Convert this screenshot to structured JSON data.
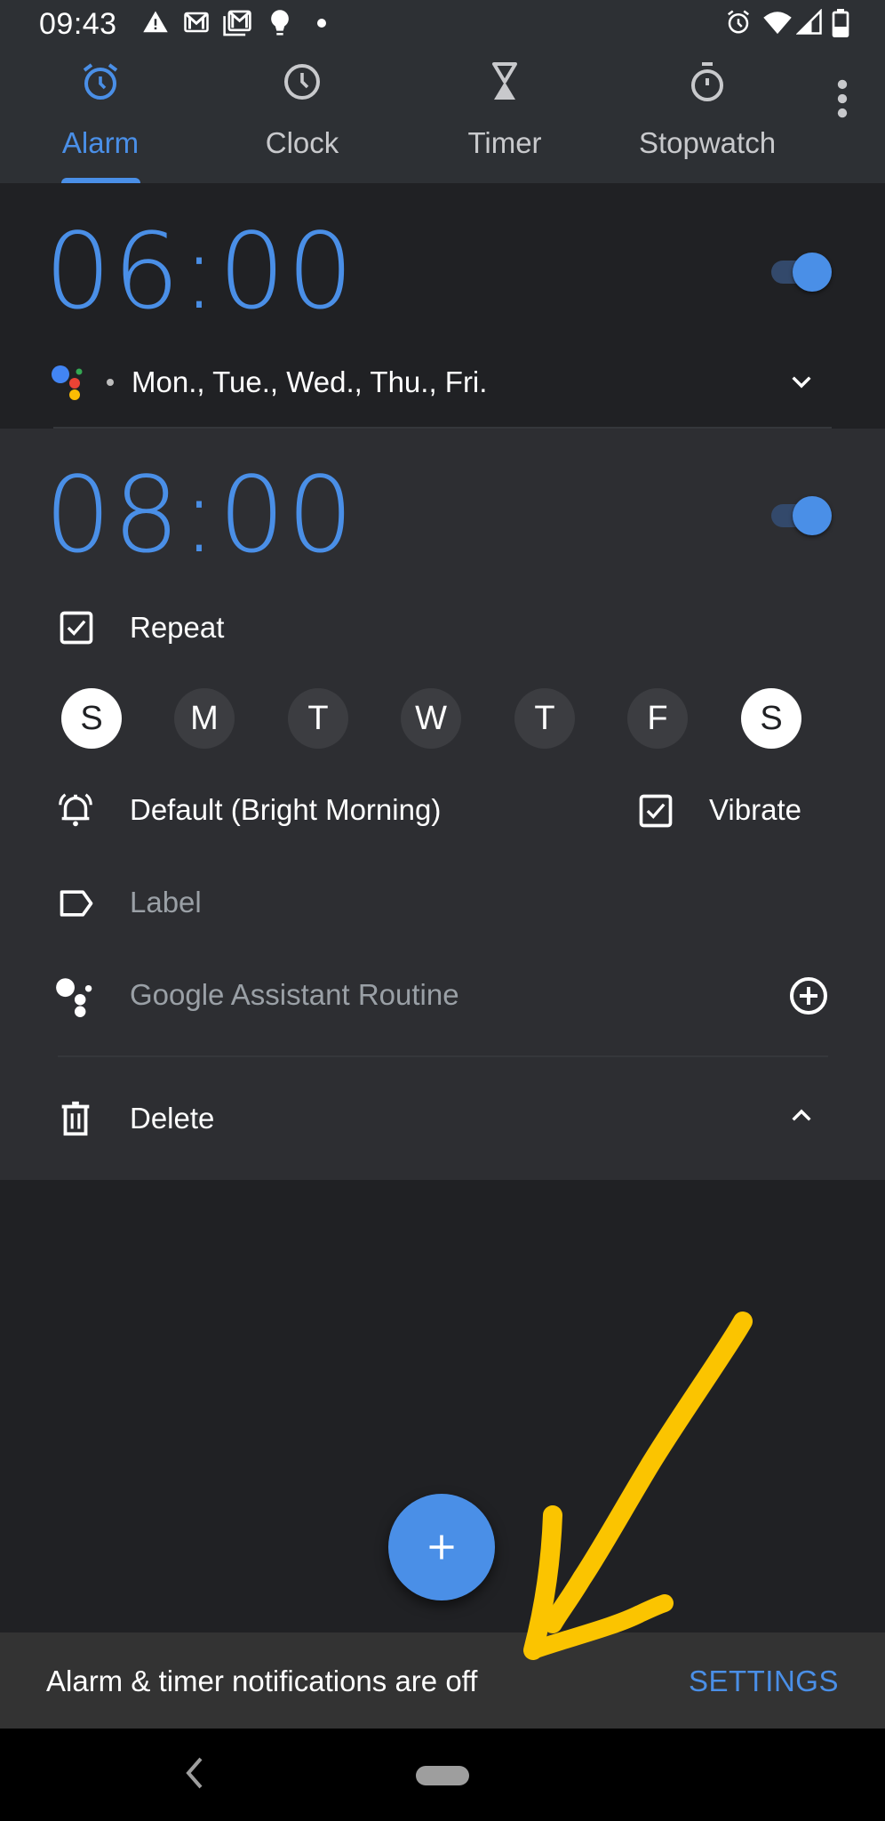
{
  "status_bar": {
    "time": "09:43",
    "left_icons": [
      "warning-icon",
      "gmail-icon",
      "gmail-stack-icon",
      "lightbulb-icon",
      "dot-icon"
    ],
    "right_icons": [
      "alarm-icon",
      "wifi-icon",
      "signal-icon",
      "battery-icon"
    ]
  },
  "tabs": [
    {
      "label": "Alarm",
      "icon": "alarm-icon",
      "active": true
    },
    {
      "label": "Clock",
      "icon": "clock-icon",
      "active": false
    },
    {
      "label": "Timer",
      "icon": "hourglass-icon",
      "active": false
    },
    {
      "label": "Stopwatch",
      "icon": "stopwatch-icon",
      "active": false
    }
  ],
  "alarms": [
    {
      "time": "06:00",
      "enabled": true,
      "days_summary": "Mon., Tue., Wed., Thu., Fri.",
      "expanded": false
    },
    {
      "time": "08:00",
      "enabled": true,
      "expanded": true,
      "repeat_label": "Repeat",
      "repeat_checked": true,
      "days": [
        {
          "letter": "S",
          "selected": true
        },
        {
          "letter": "M",
          "selected": false
        },
        {
          "letter": "T",
          "selected": false
        },
        {
          "letter": "W",
          "selected": false
        },
        {
          "letter": "T",
          "selected": false
        },
        {
          "letter": "F",
          "selected": false
        },
        {
          "letter": "S",
          "selected": true
        }
      ],
      "ringtone": "Default (Bright Morning)",
      "vibrate_label": "Vibrate",
      "vibrate_checked": true,
      "label_placeholder": "Label",
      "assistant_routine": "Google Assistant Routine",
      "delete_label": "Delete"
    }
  ],
  "fab": {
    "icon": "plus-icon"
  },
  "snackbar": {
    "message": "Alarm & timer notifications are off",
    "action": "SETTINGS"
  },
  "colors": {
    "accent": "#4a8fe7",
    "annotation": "#fbc400",
    "background": "#202124",
    "card_expanded": "#2d2e32",
    "header": "#2d3034"
  }
}
